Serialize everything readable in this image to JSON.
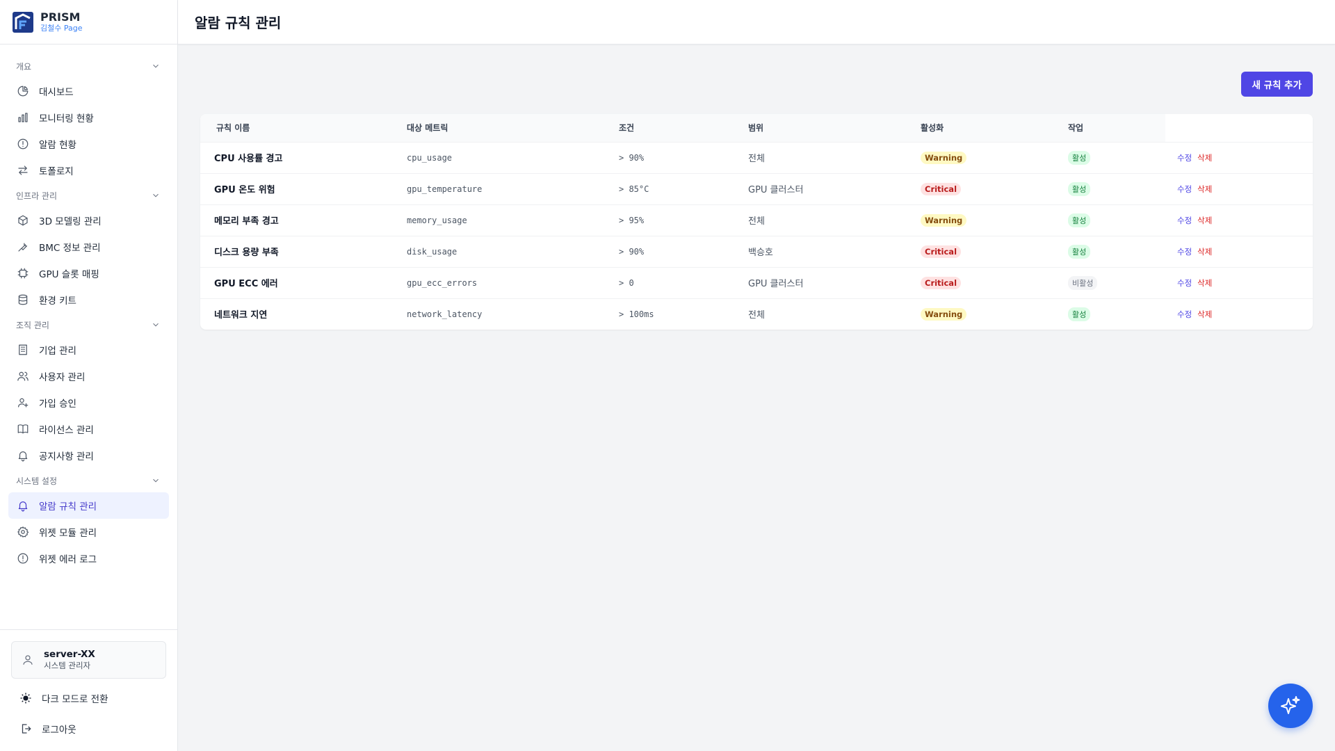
{
  "brand": {
    "name": "PRISM",
    "subtitle": "김철수 Page"
  },
  "header": {
    "title": "알람 규칙 관리"
  },
  "sidebar": {
    "sections": [
      {
        "label": "개요",
        "items": [
          {
            "label": "대시보드",
            "icon": "pie-chart-icon"
          },
          {
            "label": "모니터링 현황",
            "icon": "bar-chart-icon"
          },
          {
            "label": "알람 현황",
            "icon": "alert-circle-icon"
          },
          {
            "label": "토폴로지",
            "icon": "arrows-swap-icon"
          }
        ]
      },
      {
        "label": "인프라 관리",
        "items": [
          {
            "label": "3D 모델링 관리",
            "icon": "cube-icon"
          },
          {
            "label": "BMC 정보 관리",
            "icon": "wrench-icon"
          },
          {
            "label": "GPU 슬롯 매핑",
            "icon": "chip-icon"
          },
          {
            "label": "환경 키트",
            "icon": "database-icon"
          }
        ]
      },
      {
        "label": "조직 관리",
        "items": [
          {
            "label": "기업 관리",
            "icon": "building-icon"
          },
          {
            "label": "사용자 관리",
            "icon": "users-icon"
          },
          {
            "label": "가입 승인",
            "icon": "user-plus-icon"
          },
          {
            "label": "라이선스 관리",
            "icon": "book-icon"
          },
          {
            "label": "공지사항 관리",
            "icon": "bell-icon"
          }
        ]
      },
      {
        "label": "시스템 설정",
        "items": [
          {
            "label": "알람 규칙 관리",
            "icon": "bell-icon",
            "active": true
          },
          {
            "label": "위젯 모듈 관리",
            "icon": "gear-icon"
          },
          {
            "label": "위젯 에러 로그",
            "icon": "alert-circle-icon"
          }
        ]
      }
    ]
  },
  "footer": {
    "user_name": "server-XX",
    "user_role": "시스템 관리자",
    "dark_mode_label": "다크 모드로 전환",
    "logout_label": "로그아웃"
  },
  "toolbar": {
    "add_label": "새 규칙 추가"
  },
  "table": {
    "headers": [
      "규칙 이름",
      "대상 메트릭",
      "조건",
      "범위",
      "활성화",
      "작업"
    ],
    "rows": [
      {
        "name": "CPU 사용률 경고",
        "metric": "cpu_usage",
        "condition": "> 90%",
        "scope": "전체",
        "severity": "Warning",
        "status": "활성",
        "edit": "수정",
        "delete": "삭제"
      },
      {
        "name": "GPU 온도 위험",
        "metric": "gpu_temperature",
        "condition": "> 85°C",
        "scope": "GPU 클러스터",
        "severity": "Critical",
        "status": "활성",
        "edit": "수정",
        "delete": "삭제"
      },
      {
        "name": "메모리 부족 경고",
        "metric": "memory_usage",
        "condition": "> 95%",
        "scope": "전체",
        "severity": "Warning",
        "status": "활성",
        "edit": "수정",
        "delete": "삭제"
      },
      {
        "name": "디스크 용량 부족",
        "metric": "disk_usage",
        "condition": "> 90%",
        "scope": "백승호",
        "severity": "Critical",
        "status": "활성",
        "edit": "수정",
        "delete": "삭제"
      },
      {
        "name": "GPU ECC 에러",
        "metric": "gpu_ecc_errors",
        "condition": "> 0",
        "scope": "GPU 클러스터",
        "severity": "Critical",
        "status": "비활성",
        "edit": "수정",
        "delete": "삭제"
      },
      {
        "name": "네트워크 지연",
        "metric": "network_latency",
        "condition": "> 100ms",
        "scope": "전체",
        "severity": "Warning",
        "status": "활성",
        "edit": "수정",
        "delete": "삭제"
      }
    ]
  },
  "colors": {
    "accent": "#4f46e5",
    "fab": "#2563eb",
    "warning_bg": "#fef9c3",
    "critical_bg": "#fee2e2",
    "active_bg": "#dcfce7"
  },
  "fab": {
    "icon": "sparkles-icon"
  }
}
